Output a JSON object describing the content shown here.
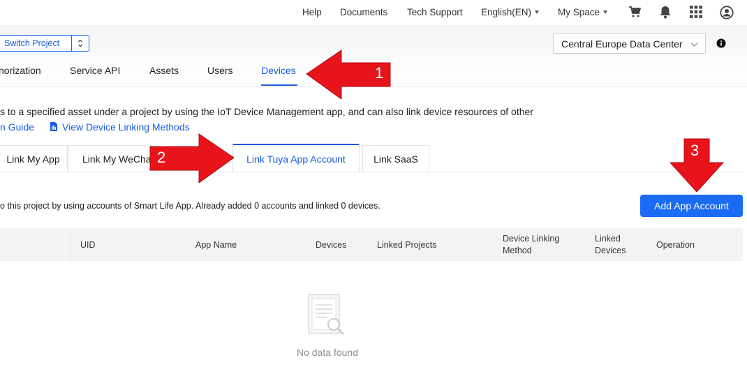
{
  "topbar": {
    "help": "Help",
    "documents": "Documents",
    "tech_support": "Tech Support",
    "language": "English(EN)",
    "my_space": "My Space",
    "icons": [
      "cart-icon",
      "bell-icon",
      "apps-grid-icon",
      "user-avatar-icon"
    ]
  },
  "project": {
    "switch_label": "Switch Project"
  },
  "datacenter": {
    "selected": "Central Europe Data Center"
  },
  "tabs": [
    {
      "label": "norization"
    },
    {
      "label": "Service API"
    },
    {
      "label": "Assets"
    },
    {
      "label": "Users"
    },
    {
      "label": "Devices",
      "active": true
    }
  ],
  "description": "s to a specified asset under a project by using the IoT Device Management app, and can also link device resources of other",
  "links": {
    "guide": "n Guide",
    "view_methods": "View Device Linking Methods"
  },
  "subtabs": [
    {
      "label": "Link My App"
    },
    {
      "label": "Link My WeCha"
    },
    {
      "label": "Link Tuya App Account",
      "active": true
    },
    {
      "label": "Link SaaS"
    }
  ],
  "summary": "o this project by using accounts of Smart Life App. Already added 0 accounts and linked 0 devices.",
  "add_button": "Add App Account",
  "table": {
    "columns": [
      "UID",
      "App Name",
      "Devices",
      "Linked Projects",
      "Device Linking Method",
      "Linked Devices",
      "Operation"
    ]
  },
  "empty_text": "No data found",
  "annotations": [
    "1",
    "2",
    "3"
  ],
  "colors": {
    "primary": "#1a6cf5",
    "annotation_red": "#e8141c",
    "header_bg": "#f2f3f5"
  }
}
